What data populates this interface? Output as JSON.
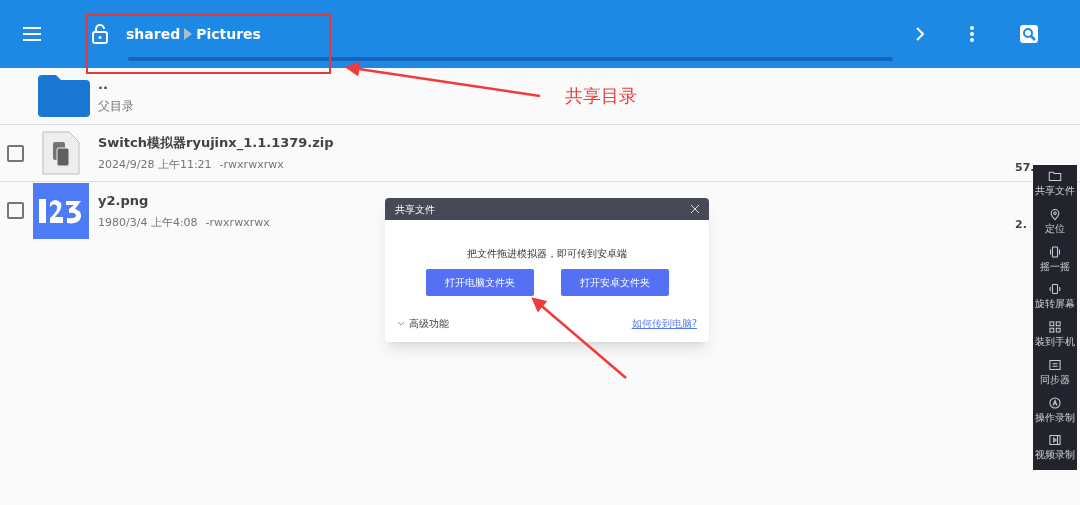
{
  "toolbar": {
    "breadcrumb": [
      "shared",
      "Pictures"
    ]
  },
  "parent_row": {
    "name": "..",
    "subtitle": "父目录"
  },
  "files": [
    {
      "name": "Switch模拟器ryujinx_1.1.1379.zip",
      "date": "2024/9/28 上午11:21",
      "permissions": "-rwxrwxrwx",
      "size": "57.",
      "checked": false,
      "kind": "archive"
    },
    {
      "name": "y2.png",
      "date": "1980/3/4 上午4:08",
      "permissions": "-rwxrwxrwx",
      "size": "2.",
      "checked": false
    }
  ],
  "dialog": {
    "title": "共享文件",
    "message": "把文件拖进模拟器，即可传到安卓端",
    "buttons": [
      "打开电脑文件夹",
      "打开安卓文件夹"
    ],
    "advanced": "高级功能",
    "expanded": false,
    "help_link": "如何传到电脑?"
  },
  "side_tools": [
    {
      "label": "共享文件"
    },
    {
      "label": "定位"
    },
    {
      "label": "摇一摇"
    },
    {
      "label": "旋转屏幕"
    },
    {
      "label": "装到手机"
    },
    {
      "label": "同步器"
    },
    {
      "label": "操作录制"
    },
    {
      "label": "视频录制"
    }
  ],
  "annotation": {
    "label": "共享目录"
  }
}
